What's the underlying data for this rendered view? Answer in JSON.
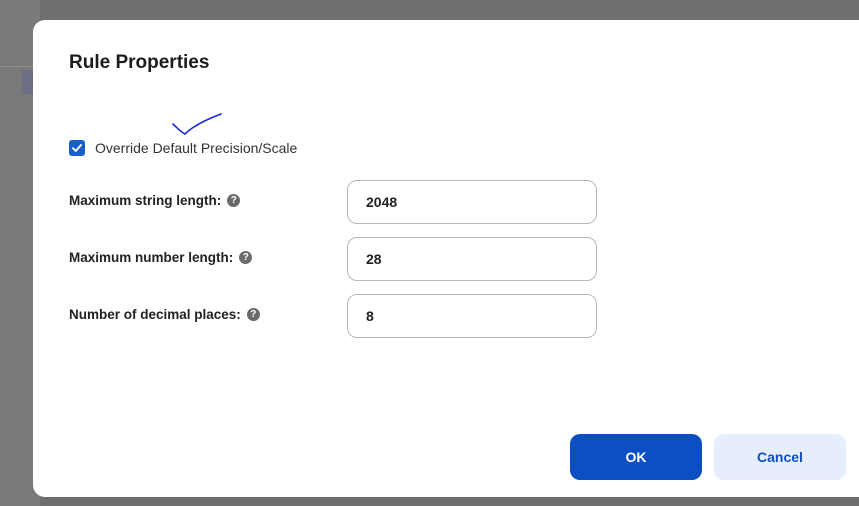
{
  "dialog": {
    "title": "Rule Properties"
  },
  "override": {
    "label": "Override Default Precision/Scale",
    "checked": true
  },
  "fields": {
    "max_string": {
      "label": "Maximum string length:",
      "value": "2048",
      "help": "?"
    },
    "max_number": {
      "label": "Maximum number length:",
      "value": "28",
      "help": "?"
    },
    "decimal_places": {
      "label": "Number of decimal places:",
      "value": "8",
      "help": "?"
    }
  },
  "buttons": {
    "ok": "OK",
    "cancel": "Cancel"
  },
  "colors": {
    "accent": "#0b4fc2",
    "checkbox": "#1560c9",
    "cancel_bg": "#e7eefb",
    "annotation_ink": "#1a2bd6"
  },
  "icons": {
    "help": "question-circle-icon",
    "check": "checkmark-icon",
    "annotation": "handwritten-checkmark"
  }
}
